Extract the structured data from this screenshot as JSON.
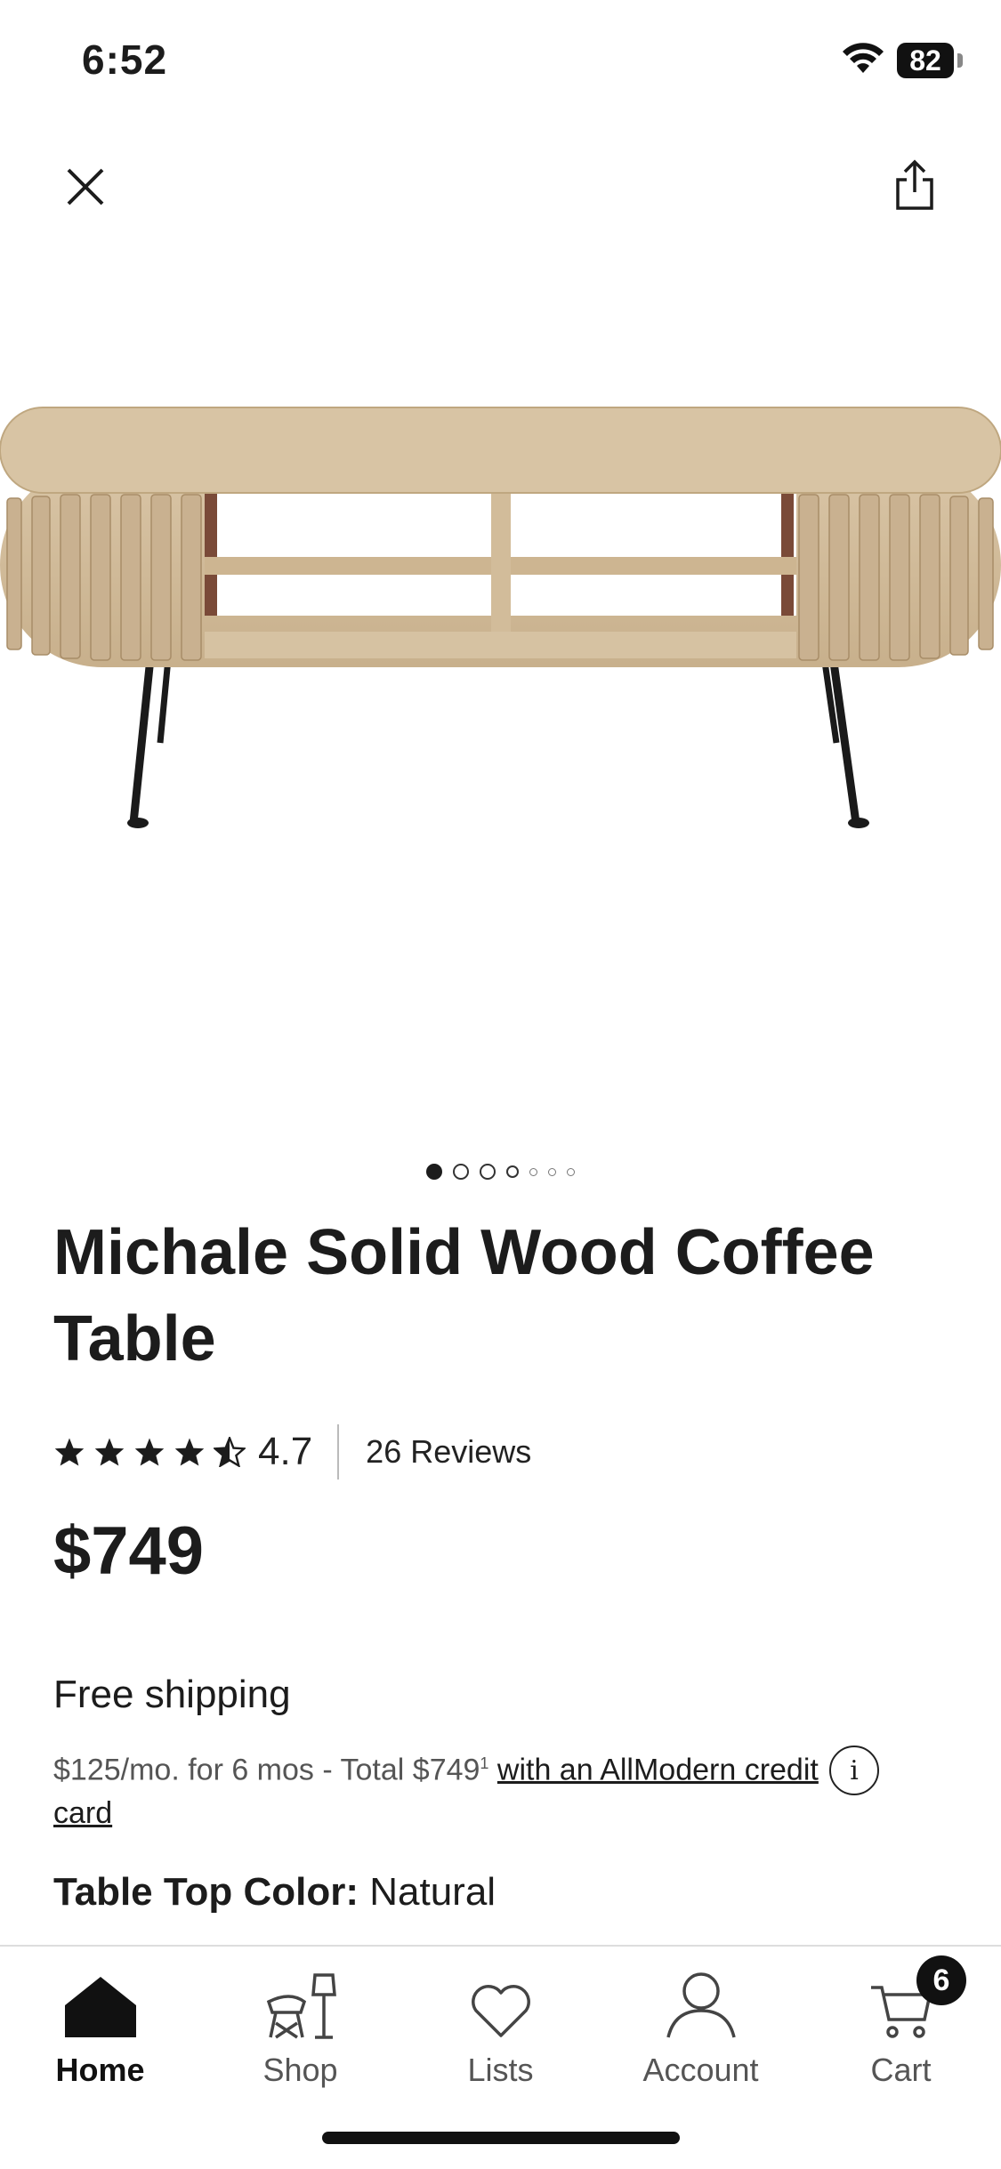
{
  "status_bar": {
    "time": "6:52",
    "battery": "82"
  },
  "header": {
    "close_icon": "close-icon",
    "share_icon": "share-icon"
  },
  "product": {
    "image_icon": "coffee-table-photo",
    "image_dots": {
      "count": 7,
      "active_index": 0
    },
    "title": "Michale Solid Wood Coffee Table",
    "rating": {
      "value": "4.7",
      "stars": 4.5,
      "reviews": "26 Reviews"
    },
    "price": "$749",
    "shipping": "Free shipping",
    "financing": {
      "text": "$125/mo. for 6 mos - Total $749",
      "superscript": "1",
      "link_text": "with an AllModern credit card"
    },
    "option": {
      "label": "Table Top Color:",
      "value": "Natural"
    }
  },
  "tab_bar": {
    "tabs": [
      {
        "label": "Home",
        "icon": "home-icon",
        "active": true
      },
      {
        "label": "Shop",
        "icon": "chair-lamp-icon",
        "active": false
      },
      {
        "label": "Lists",
        "icon": "heart-icon",
        "active": false
      },
      {
        "label": "Account",
        "icon": "person-icon",
        "active": false
      },
      {
        "label": "Cart",
        "icon": "cart-icon",
        "active": false
      }
    ],
    "cart_count": "6"
  }
}
